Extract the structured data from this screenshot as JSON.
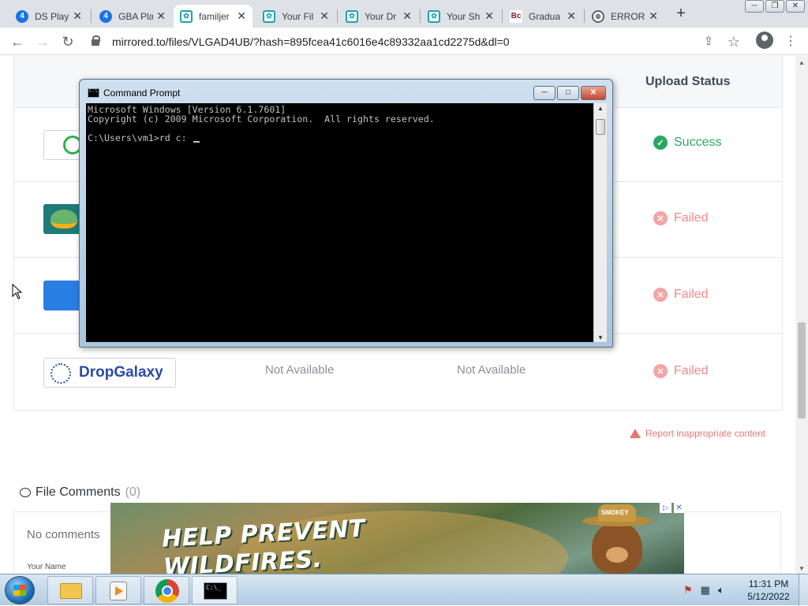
{
  "browser": {
    "tabs": [
      {
        "title": "DS Play",
        "icon": "blue",
        "glyph": "4",
        "active": false
      },
      {
        "title": "GBA Pla",
        "icon": "blue",
        "glyph": "4",
        "active": false
      },
      {
        "title": "familjer",
        "icon": "teal",
        "glyph": "✿",
        "active": true
      },
      {
        "title": "Your Fil",
        "icon": "teal",
        "glyph": "✿",
        "active": false
      },
      {
        "title": "Your Dr",
        "icon": "teal",
        "glyph": "✿",
        "active": false
      },
      {
        "title": "Your Sh",
        "icon": "teal",
        "glyph": "✿",
        "active": false
      },
      {
        "title": "Gradua",
        "icon": "maroon",
        "glyph": "Bc",
        "active": false
      },
      {
        "title": "ERROR",
        "icon": "globe",
        "glyph": "◍",
        "active": false
      }
    ],
    "new_tab_label": "+",
    "url": "mirrored.to/files/VLGAD4UB/?hash=895fcea41c6016e4c89332aa1cd2275d&dl=0"
  },
  "table": {
    "header_status": "Upload Status",
    "rows": [
      {
        "status": "Success",
        "kind": "ok",
        "logo": "",
        "link": "",
        "hash": ""
      },
      {
        "status": "Failed",
        "kind": "bad",
        "logo": "",
        "link": "",
        "hash": ""
      },
      {
        "status": "Failed",
        "kind": "bad",
        "logo": "",
        "link": "",
        "hash": ""
      },
      {
        "status": "Failed",
        "kind": "bad",
        "logo": "DropGalaxy",
        "link": "Not Available",
        "hash": "Not Available"
      }
    ]
  },
  "report_link": "Report inappropriate content",
  "comments": {
    "title": "File Comments",
    "count": "(0)",
    "empty_text": "No comments",
    "name_label": "Your Name"
  },
  "ad": {
    "headline_line1": "HELP PREVENT",
    "headline_line2": "WILDFIRES.",
    "badge": "SMOKEY"
  },
  "cmd": {
    "title": "Command Prompt",
    "lines": [
      "Microsoft Windows [Version 6.1.7601]",
      "Copyright (c) 2009 Microsoft Corporation.  All rights reserved.",
      "",
      "C:\\Users\\vm1>rd c: "
    ]
  },
  "taskbar": {
    "time": "11:31 PM",
    "date": "5/12/2022"
  },
  "colors": {
    "success": "#28a760",
    "failed": "#f08a8a",
    "report": "#e37a72"
  }
}
